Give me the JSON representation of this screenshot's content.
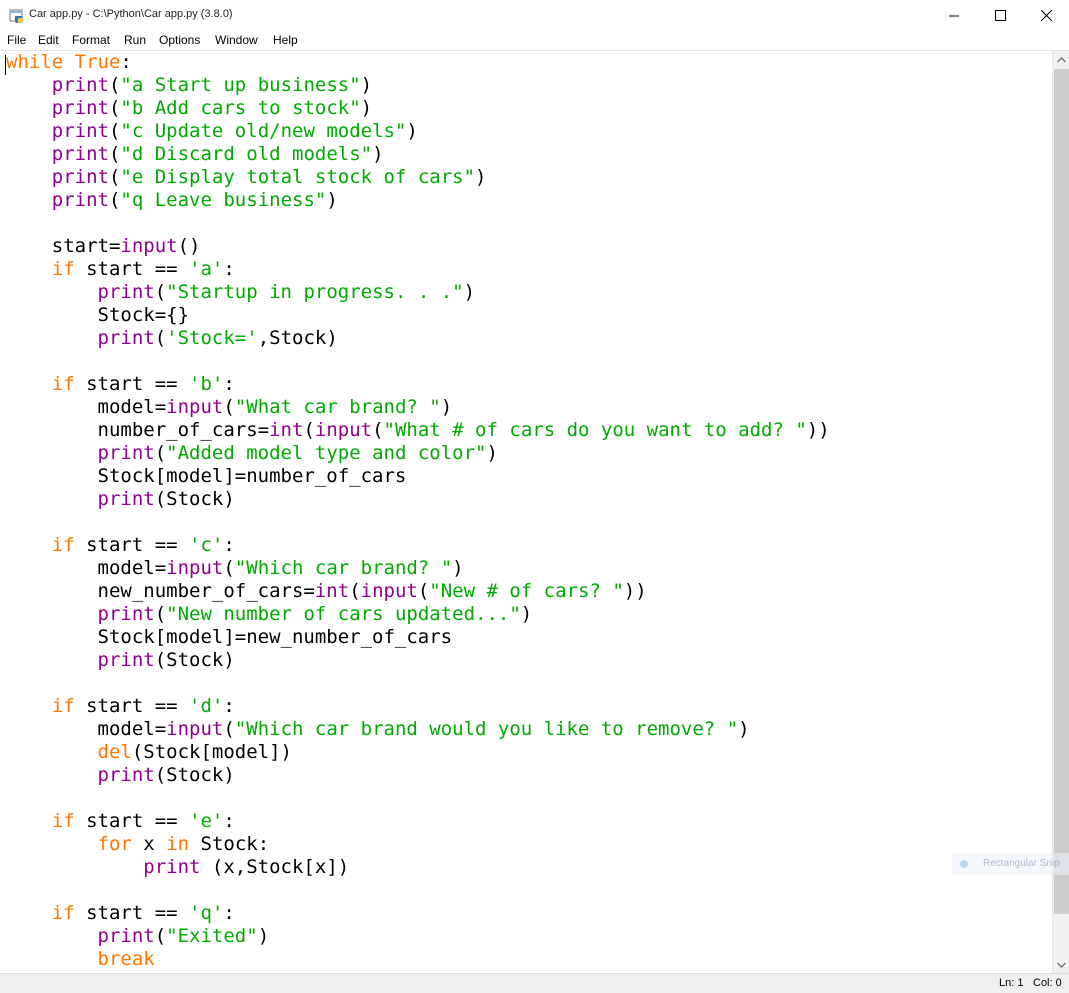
{
  "window": {
    "title": "Car app.py - C:\\Python\\Car app.py (3.8.0)",
    "icons": {
      "app": "python-idle-icon",
      "minimize": "minimize-icon",
      "maximize": "maximize-icon",
      "close": "close-icon"
    }
  },
  "menu": {
    "items": [
      "File",
      "Edit",
      "Format",
      "Run",
      "Options",
      "Window",
      "Help"
    ]
  },
  "editor": {
    "colors": {
      "keyword": "#ff7700",
      "builtin": "#900090",
      "string": "#00aa00",
      "text": "#000000"
    },
    "lines": [
      [
        {
          "t": "while",
          "c": "kw"
        },
        {
          "t": " "
        },
        {
          "t": "True",
          "c": "kw"
        },
        {
          "t": ":"
        }
      ],
      [
        {
          "t": "    "
        },
        {
          "t": "print",
          "c": "bi"
        },
        {
          "t": "("
        },
        {
          "t": "\"a Start up business\"",
          "c": "st"
        },
        {
          "t": ")"
        }
      ],
      [
        {
          "t": "    "
        },
        {
          "t": "print",
          "c": "bi"
        },
        {
          "t": "("
        },
        {
          "t": "\"b Add cars to stock\"",
          "c": "st"
        },
        {
          "t": ")"
        }
      ],
      [
        {
          "t": "    "
        },
        {
          "t": "print",
          "c": "bi"
        },
        {
          "t": "("
        },
        {
          "t": "\"c Update old/new models\"",
          "c": "st"
        },
        {
          "t": ")"
        }
      ],
      [
        {
          "t": "    "
        },
        {
          "t": "print",
          "c": "bi"
        },
        {
          "t": "("
        },
        {
          "t": "\"d Discard old models\"",
          "c": "st"
        },
        {
          "t": ")"
        }
      ],
      [
        {
          "t": "    "
        },
        {
          "t": "print",
          "c": "bi"
        },
        {
          "t": "("
        },
        {
          "t": "\"e Display total stock of cars\"",
          "c": "st"
        },
        {
          "t": ")"
        }
      ],
      [
        {
          "t": "    "
        },
        {
          "t": "print",
          "c": "bi"
        },
        {
          "t": "("
        },
        {
          "t": "\"q Leave business\"",
          "c": "st"
        },
        {
          "t": ")"
        }
      ],
      [],
      [
        {
          "t": "    start="
        },
        {
          "t": "input",
          "c": "bi"
        },
        {
          "t": "()"
        }
      ],
      [
        {
          "t": "    "
        },
        {
          "t": "if",
          "c": "kw"
        },
        {
          "t": " start == "
        },
        {
          "t": "'a'",
          "c": "st"
        },
        {
          "t": ":"
        }
      ],
      [
        {
          "t": "        "
        },
        {
          "t": "print",
          "c": "bi"
        },
        {
          "t": "("
        },
        {
          "t": "\"Startup in progress. . .\"",
          "c": "st"
        },
        {
          "t": ")"
        }
      ],
      [
        {
          "t": "        Stock={}"
        }
      ],
      [
        {
          "t": "        "
        },
        {
          "t": "print",
          "c": "bi"
        },
        {
          "t": "("
        },
        {
          "t": "'Stock='",
          "c": "st"
        },
        {
          "t": ",Stock)"
        }
      ],
      [],
      [
        {
          "t": "    "
        },
        {
          "t": "if",
          "c": "kw"
        },
        {
          "t": " start == "
        },
        {
          "t": "'b'",
          "c": "st"
        },
        {
          "t": ":"
        }
      ],
      [
        {
          "t": "        model="
        },
        {
          "t": "input",
          "c": "bi"
        },
        {
          "t": "("
        },
        {
          "t": "\"What car brand? \"",
          "c": "st"
        },
        {
          "t": ")"
        }
      ],
      [
        {
          "t": "        number_of_cars="
        },
        {
          "t": "int",
          "c": "bi"
        },
        {
          "t": "("
        },
        {
          "t": "input",
          "c": "bi"
        },
        {
          "t": "("
        },
        {
          "t": "\"What # of cars do you want to add? \"",
          "c": "st"
        },
        {
          "t": "))"
        }
      ],
      [
        {
          "t": "        "
        },
        {
          "t": "print",
          "c": "bi"
        },
        {
          "t": "("
        },
        {
          "t": "\"Added model type and color\"",
          "c": "st"
        },
        {
          "t": ")"
        }
      ],
      [
        {
          "t": "        Stock[model]=number_of_cars"
        }
      ],
      [
        {
          "t": "        "
        },
        {
          "t": "print",
          "c": "bi"
        },
        {
          "t": "(Stock)"
        }
      ],
      [],
      [
        {
          "t": "    "
        },
        {
          "t": "if",
          "c": "kw"
        },
        {
          "t": " start == "
        },
        {
          "t": "'c'",
          "c": "st"
        },
        {
          "t": ":"
        }
      ],
      [
        {
          "t": "        model="
        },
        {
          "t": "input",
          "c": "bi"
        },
        {
          "t": "("
        },
        {
          "t": "\"Which car brand? \"",
          "c": "st"
        },
        {
          "t": ")"
        }
      ],
      [
        {
          "t": "        new_number_of_cars="
        },
        {
          "t": "int",
          "c": "bi"
        },
        {
          "t": "("
        },
        {
          "t": "input",
          "c": "bi"
        },
        {
          "t": "("
        },
        {
          "t": "\"New # of cars? \"",
          "c": "st"
        },
        {
          "t": "))"
        }
      ],
      [
        {
          "t": "        "
        },
        {
          "t": "print",
          "c": "bi"
        },
        {
          "t": "("
        },
        {
          "t": "\"New number of cars updated...\"",
          "c": "st"
        },
        {
          "t": ")"
        }
      ],
      [
        {
          "t": "        Stock[model]=new_number_of_cars"
        }
      ],
      [
        {
          "t": "        "
        },
        {
          "t": "print",
          "c": "bi"
        },
        {
          "t": "(Stock)"
        }
      ],
      [],
      [
        {
          "t": "    "
        },
        {
          "t": "if",
          "c": "kw"
        },
        {
          "t": " start == "
        },
        {
          "t": "'d'",
          "c": "st"
        },
        {
          "t": ":"
        }
      ],
      [
        {
          "t": "        model="
        },
        {
          "t": "input",
          "c": "bi"
        },
        {
          "t": "("
        },
        {
          "t": "\"Which car brand would you like to remove? \"",
          "c": "st"
        },
        {
          "t": ")"
        }
      ],
      [
        {
          "t": "        "
        },
        {
          "t": "del",
          "c": "kw"
        },
        {
          "t": "(Stock[model])"
        }
      ],
      [
        {
          "t": "        "
        },
        {
          "t": "print",
          "c": "bi"
        },
        {
          "t": "(Stock)"
        }
      ],
      [],
      [
        {
          "t": "    "
        },
        {
          "t": "if",
          "c": "kw"
        },
        {
          "t": " start == "
        },
        {
          "t": "'e'",
          "c": "st"
        },
        {
          "t": ":"
        }
      ],
      [
        {
          "t": "        "
        },
        {
          "t": "for",
          "c": "kw"
        },
        {
          "t": " x "
        },
        {
          "t": "in",
          "c": "kw"
        },
        {
          "t": " Stock:"
        }
      ],
      [
        {
          "t": "            "
        },
        {
          "t": "print",
          "c": "bi"
        },
        {
          "t": " (x,Stock[x])"
        }
      ],
      [],
      [
        {
          "t": "    "
        },
        {
          "t": "if",
          "c": "kw"
        },
        {
          "t": " start == "
        },
        {
          "t": "'q'",
          "c": "st"
        },
        {
          "t": ":"
        }
      ],
      [
        {
          "t": "        "
        },
        {
          "t": "print",
          "c": "bi"
        },
        {
          "t": "("
        },
        {
          "t": "\"Exited\"",
          "c": "st"
        },
        {
          "t": ")"
        }
      ],
      [
        {
          "t": "        "
        },
        {
          "t": "break",
          "c": "kw"
        }
      ]
    ]
  },
  "overlay": {
    "snip_label": "Rectangular Snip"
  },
  "status": {
    "line": "Ln: 1",
    "col": "Col: 0"
  }
}
